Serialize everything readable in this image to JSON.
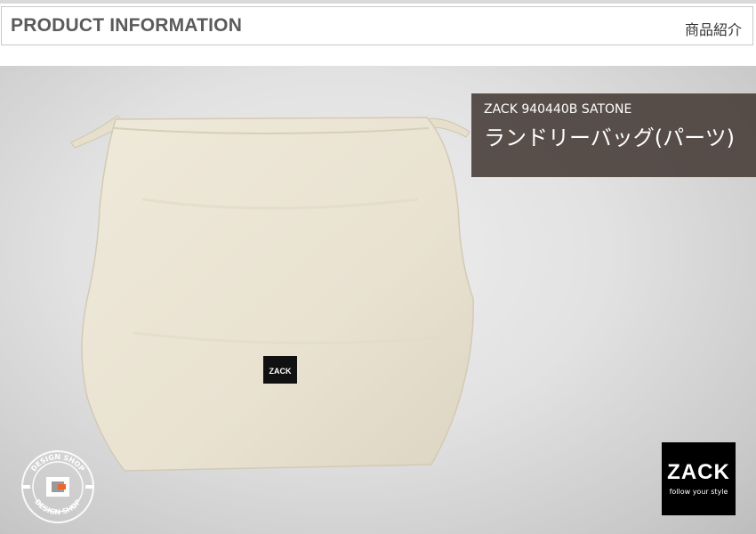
{
  "header": {
    "title": "PRODUCT INFORMATION",
    "subtitle": "商品紹介"
  },
  "caption": {
    "model": "ZACK 940440B SATONE",
    "name": "ランドリーバッグ(パーツ)"
  },
  "logo": {
    "brand": "ZACK",
    "tagline": "follow your style",
    "bag_label": "ZACK",
    "accent": "#2ec4b6"
  },
  "badge": {
    "text_top": "DESIGN SHOP",
    "text_bottom": "DESIGN SHOP",
    "accent": "#e8692a"
  },
  "colors": {
    "bag": "#ece6d6",
    "caption_bg": "#483e3a"
  }
}
